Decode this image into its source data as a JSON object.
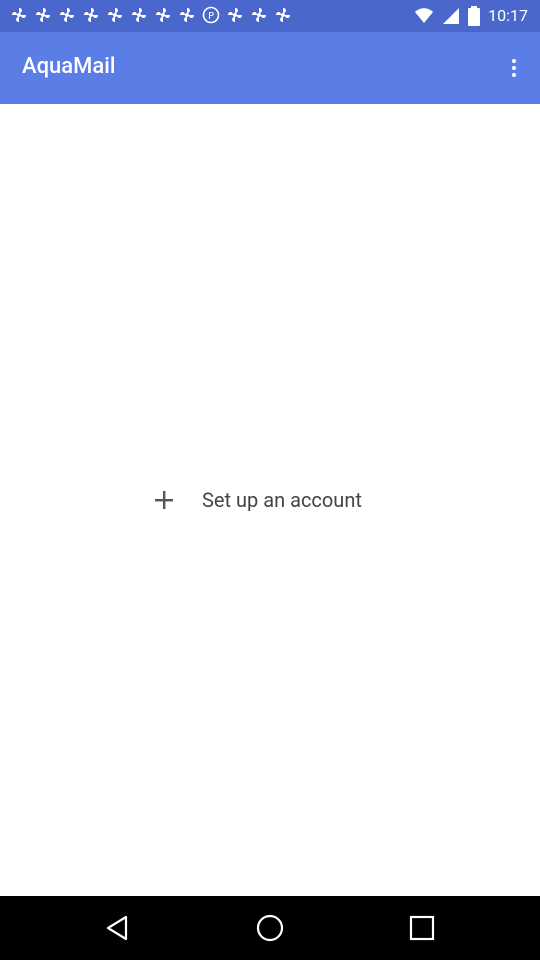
{
  "status_bar": {
    "time": "10:17",
    "notification_icons": [
      "pinwheel-icon",
      "pinwheel-icon",
      "pinwheel-icon",
      "pinwheel-icon",
      "pinwheel-icon",
      "pinwheel-icon",
      "pinwheel-icon",
      "pinwheel-icon",
      "p-icon",
      "pinwheel-icon",
      "pinwheel-icon",
      "pinwheel-icon"
    ],
    "status_icons": [
      "wifi-icon",
      "signal-icon",
      "battery-icon"
    ]
  },
  "app_bar": {
    "title": "AquaMail",
    "overflow_icon": "more-vert-icon"
  },
  "main": {
    "setup_label": "Set up an account",
    "setup_icon": "plus-icon"
  },
  "nav_bar": {
    "buttons": [
      "back-icon",
      "home-icon",
      "recents-icon"
    ]
  },
  "colors": {
    "status_bar": "#4a68cc",
    "app_bar": "#5b7de6",
    "background": "#ffffff",
    "nav_bar": "#000000"
  }
}
